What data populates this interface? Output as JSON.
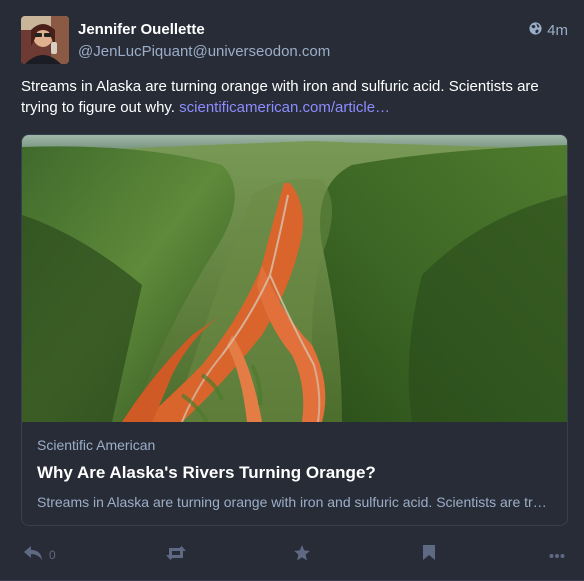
{
  "status": {
    "author": {
      "display_name": "Jennifer Ouellette",
      "handle": "@JenLucPiquant@universeodon.com"
    },
    "visibility_icon": "globe-icon",
    "relative_time": "4m",
    "content_text": "Streams in Alaska are turning orange with iron and sulfuric acid. Scientists are trying to figure out why.",
    "content_link": "scientificamerican.com/article…",
    "card": {
      "provider": "Scientific American",
      "title": "Why Are Alaska's Rivers Turning Orange?",
      "description": "Streams in Alaska are turning orange with iron and sulfuric acid. Scientists are trying to figure out why."
    },
    "actions": {
      "reply_count": "0",
      "reply_icon": "reply-icon",
      "boost_icon": "boost-icon",
      "favourite_icon": "star-icon",
      "bookmark_icon": "bookmark-icon",
      "more_icon": "more-icon"
    }
  },
  "colors": {
    "background": "#282c37",
    "secondary_text": "#9baec8",
    "link": "#8c8dff",
    "action_icon": "#606984"
  }
}
